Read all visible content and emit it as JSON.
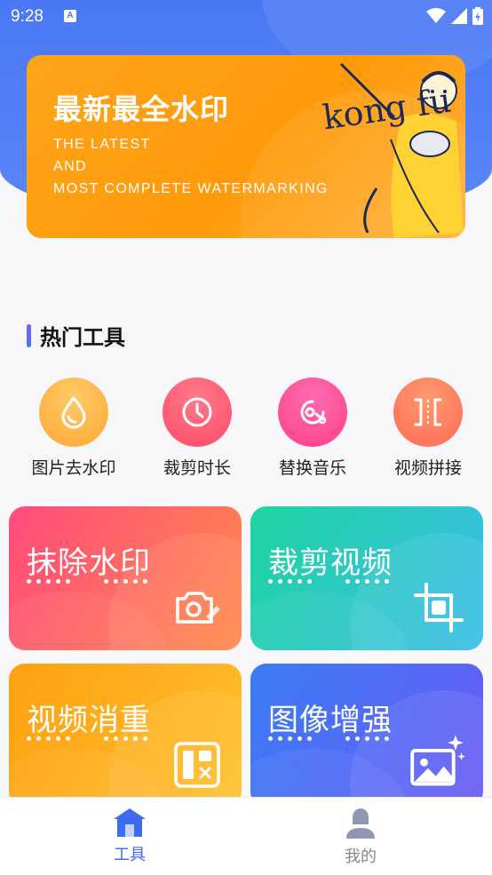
{
  "status_bar": {
    "time": "9:28",
    "notification_glyph": "A"
  },
  "banner": {
    "title": "最新最全水印",
    "subtitle_lines": [
      "THE LATEST",
      "AND",
      "MOST COMPLETE WATERMARKING"
    ],
    "art_text": "kong fu"
  },
  "section": {
    "title": "热门工具"
  },
  "tools": [
    {
      "label": "图片去水印",
      "icon": "water-drop-icon",
      "color": "#ffb648"
    },
    {
      "label": "裁剪时长",
      "icon": "clock-icon",
      "color": "#ff5a73"
    },
    {
      "label": "替换音乐",
      "icon": "music-disc-icon",
      "color": "#ff4f9b"
    },
    {
      "label": "视频拼接",
      "icon": "splice-icon",
      "color": "#ff7a5a"
    }
  ],
  "cards": [
    {
      "title": "抹除水印",
      "icon": "camera-erase-icon",
      "gradient": [
        "#ff4b7d",
        "#ff8a4a"
      ]
    },
    {
      "title": "裁剪视频",
      "icon": "crop-icon",
      "gradient": [
        "#1fd0a3",
        "#3cbfe8"
      ]
    },
    {
      "title": "视频消重",
      "icon": "video-dedupe-icon",
      "gradient": [
        "#ffa11a",
        "#ffbf2e"
      ]
    },
    {
      "title": "图像增强",
      "icon": "image-enhance-icon",
      "gradient": [
        "#3d78f6",
        "#6a5bf5"
      ]
    }
  ],
  "bottom_nav": {
    "items": [
      {
        "label": "工具",
        "icon": "home-icon",
        "active": true
      },
      {
        "label": "我的",
        "icon": "user-icon",
        "active": false
      }
    ],
    "active_color": "#3d6cf0",
    "inactive_color": "#888888"
  }
}
